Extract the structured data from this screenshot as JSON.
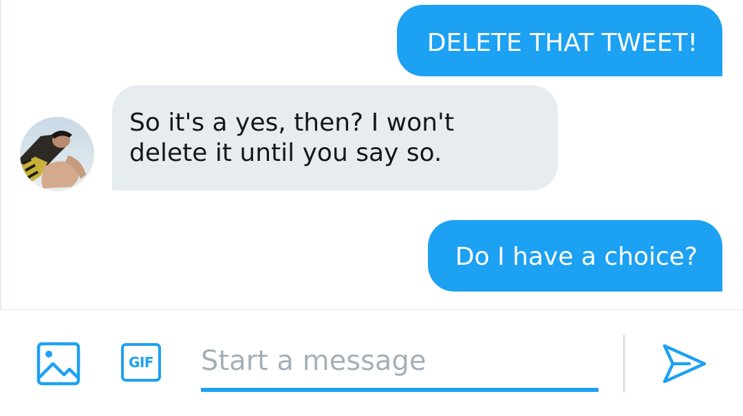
{
  "conversation": {
    "messages": [
      {
        "sender": "me",
        "text": "DELETE THAT TWEET!"
      },
      {
        "sender": "other",
        "text": "So it's a yes, then? I won't delete it until you say so."
      },
      {
        "sender": "me",
        "text": "Do I have a choice?"
      }
    ],
    "avatar": "profile-photo"
  },
  "composer": {
    "image_icon": "image-icon",
    "gif_label": "GIF",
    "input_value": "",
    "input_placeholder": "Start a message",
    "send_icon": "send-icon"
  },
  "colors": {
    "accent": "#1da1f2",
    "incoming_bubble": "#e6ecf0",
    "incoming_text": "#14171a",
    "placeholder": "#a4afb7"
  }
}
